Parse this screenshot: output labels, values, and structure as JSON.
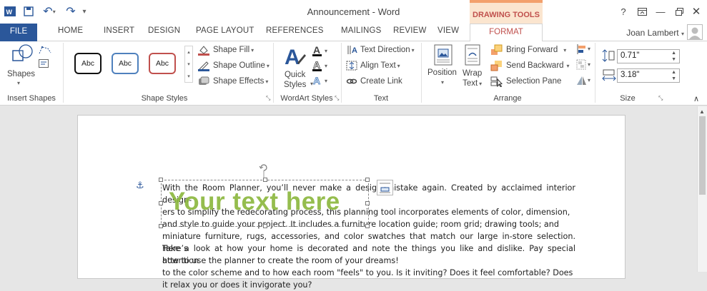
{
  "window": {
    "title": "Announcement - Word",
    "context_tab_title": "DRAWING TOOLS",
    "help": "?",
    "user_name": "Joan Lambert"
  },
  "tabs": [
    "FILE",
    "HOME",
    "INSERT",
    "DESIGN",
    "PAGE LAYOUT",
    "REFERENCES",
    "MAILINGS",
    "REVIEW",
    "VIEW",
    "FORMAT"
  ],
  "ribbon": {
    "insert_shapes": {
      "label": "Insert Shapes",
      "shapes_label": "Shapes"
    },
    "shape_styles": {
      "label": "Shape Styles",
      "presets": [
        "Abc",
        "Abc",
        "Abc"
      ],
      "preset_colors": [
        "#000000",
        "#4f81bd",
        "#c0504d"
      ],
      "fill": "Shape Fill",
      "outline": "Shape Outline",
      "effects": "Shape Effects"
    },
    "wordart_styles": {
      "label": "WordArt Styles",
      "quick_styles_1": "Quick",
      "quick_styles_2": "Styles"
    },
    "text": {
      "label": "Text",
      "direction": "Text Direction",
      "align": "Align Text",
      "link": "Create Link"
    },
    "arrange": {
      "label": "Arrange",
      "position": "Position",
      "wrap_1": "Wrap",
      "wrap_2": "Text",
      "bring_forward": "Bring Forward",
      "send_backward": "Send Backward",
      "selection_pane": "Selection Pane"
    },
    "size": {
      "label": "Size",
      "height": "0.71\"",
      "width": "3.18\""
    }
  },
  "document": {
    "wordart_text": "Your text here",
    "paragraph1_lines": [
      "With the Room Planner, you’ll never make a design mistake again. Created by acclaimed interior design-",
      "ers to simplify the redecorating process, this planning tool incorporates elements of color, dimension,",
      "and style to guide your project. It includes a furniture location guide; room grid; drawing tools; and",
      "miniature furniture, rugs, accessories, and color swatches that match our large in-store selection. Here’s",
      "how to use the planner to create the room of your dreams!"
    ],
    "paragraph2_lines": [
      "Take a look at how your home is decorated and note the things you like and dislike. Pay special attention",
      "to the color scheme and to how each room \"feels\" to you. Is it inviting? Does it feel comfortable? Does",
      "it relax you or does it invigorate you?"
    ]
  },
  "colors": {
    "accent": "#2b579a",
    "context": "#c0504d",
    "wordart": "#8db83f"
  }
}
